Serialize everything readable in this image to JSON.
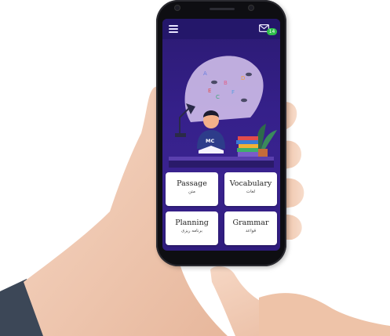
{
  "app": {
    "notification_count": "14",
    "illustration": {
      "letters": [
        "A",
        "B",
        "C",
        "D",
        "E",
        "F"
      ],
      "shirt_text": "MC"
    }
  },
  "menu_cards": [
    {
      "title": "Passage",
      "subtitle": "متن"
    },
    {
      "title": "Vocabulary",
      "subtitle": "لغات"
    },
    {
      "title": "Planning",
      "subtitle": "برنامه ریزی"
    },
    {
      "title": "Grammar",
      "subtitle": "قواعد"
    }
  ],
  "colors": {
    "screen_bg": "#35208a",
    "topbar": "#24176a",
    "badge": "#2fbf4a",
    "card_bg": "#ffffff"
  },
  "icons": [
    "hamburger-menu-icon",
    "mail-icon"
  ]
}
